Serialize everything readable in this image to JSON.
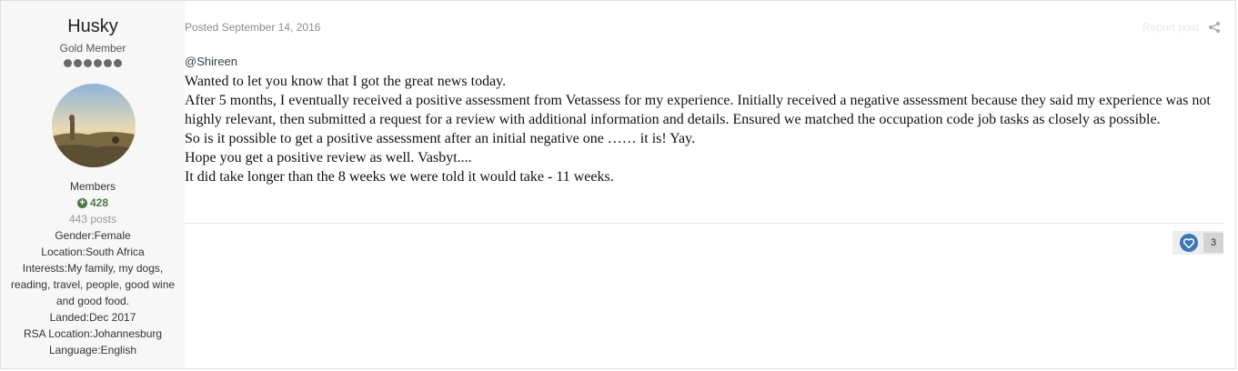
{
  "author": {
    "name": "Husky",
    "rank": "Gold Member",
    "group": "Members",
    "reputation": "428",
    "posts": "443 posts",
    "fields": [
      "Gender:Female",
      "Location:South Africa",
      "Interests:My family, my dogs, reading, travel, people, good wine and good food.",
      "Landed:Dec 2017",
      "RSA Location:Johannesburg",
      "Language:English"
    ]
  },
  "post": {
    "posted_label": "Posted September 14, 2016",
    "report_label": "Report post",
    "mention": "@Shireen",
    "paragraphs": [
      "Wanted to let you know that I got the great news today.",
      "After 5 months, I eventually received a positive assessment from Vetassess for my experience. Initially received a negative assessment because they said my experience was not highly relevant, then submitted a request for a review with additional information and details. Ensured we matched the occupation code job tasks as closely as possible.",
      "So is it possible to get a positive assessment after an initial negative one …… it is! Yay.",
      "Hope you get a positive review as well. Vasbyt....",
      "It did take longer than the 8 weeks we were told it would take - 11 weeks."
    ],
    "reaction_count": "3"
  },
  "colors": {
    "reputation_green": "#4d7a41",
    "reaction_blue": "#3a78b4"
  },
  "icons": {
    "rank": "rank-pip-icons",
    "reputation": "plus-circle-icon",
    "share": "share-icon",
    "reaction": "heart-icon"
  }
}
